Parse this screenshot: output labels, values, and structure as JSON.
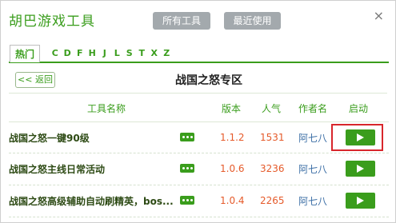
{
  "app": {
    "title": "胡巴游戏工具"
  },
  "toolbar": {
    "all_tools": "所有工具",
    "recent": "最近使用",
    "close": "×"
  },
  "tabs": {
    "hot": "热门",
    "letters": [
      "C",
      "D",
      "F",
      "H",
      "J",
      "L",
      "S",
      "T",
      "X",
      "Z"
    ]
  },
  "section": {
    "back_label": "<< 返回",
    "title": "战国之怒专区"
  },
  "columns": {
    "name": "工具名称",
    "version": "版本",
    "popularity": "人气",
    "author": "作者名",
    "launch": "启动"
  },
  "tools": [
    {
      "name": "战国之怒一键90级",
      "version": "1.1.2",
      "popularity": "1531",
      "author": "阿七八"
    },
    {
      "name": "战国之怒主线日常活动",
      "version": "1.0.6",
      "popularity": "3236",
      "author": "阿七八"
    },
    {
      "name": "战国之怒高级辅助自动刷精英，bos...",
      "version": "1.0.4",
      "popularity": "2265",
      "author": "阿七八"
    }
  ],
  "colors": {
    "accent": "#3a9d1c",
    "number": "#e55a2a",
    "author": "#3d6fa6",
    "highlight": "#d8262c"
  },
  "icons": {
    "more": "more-dots-icon",
    "play": "play-icon",
    "close": "close-icon"
  }
}
